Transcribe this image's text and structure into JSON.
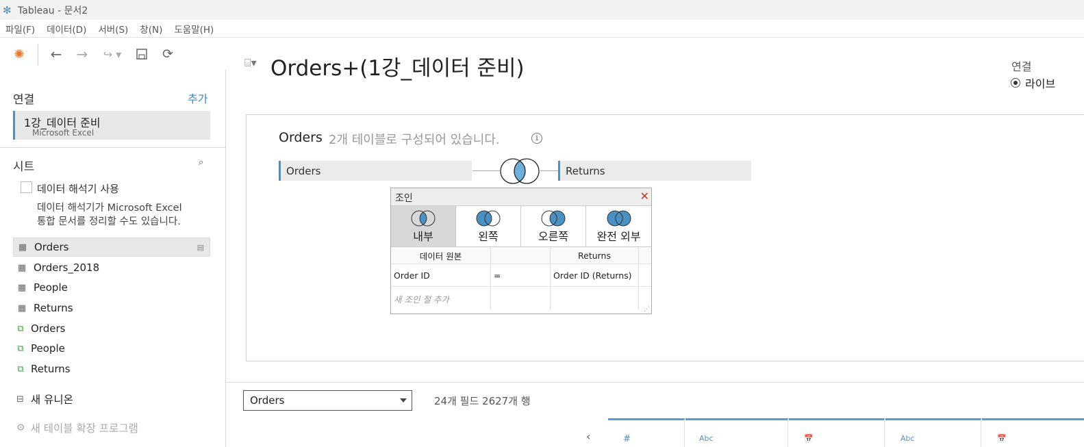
{
  "window": {
    "title": "Tableau - 문서2"
  },
  "menu": [
    "파일(F)",
    "데이터(D)",
    "서버(S)",
    "창(N)",
    "도움말(H)"
  ],
  "sidebar": {
    "connections_title": "연결",
    "add_label": "추가",
    "connection": {
      "name": "1강_데이터 준비",
      "type": "Microsoft Excel"
    },
    "sheets_title": "시트",
    "interpreter_label": "데이터 해석기 사용",
    "interpreter_hint_1": "데이터 해석기가 Microsoft Excel",
    "interpreter_hint_2": "통합 문서를 정리할 수도 있습니다.",
    "sheets": [
      {
        "label": "Orders",
        "kind": "table"
      },
      {
        "label": "Orders_2018",
        "kind": "table"
      },
      {
        "label": "People",
        "kind": "table"
      },
      {
        "label": "Returns",
        "kind": "table"
      },
      {
        "label": "Orders",
        "kind": "named-range"
      },
      {
        "label": "People",
        "kind": "named-range"
      },
      {
        "label": "Returns",
        "kind": "named-range"
      }
    ],
    "new_union": "새 유니온",
    "new_extension": "새 테이블 확장 프로그램"
  },
  "main": {
    "title": "Orders+(1강_데이터 준비)",
    "connection_label": "연결",
    "live_label": "라이브",
    "logical_table": "Orders",
    "logical_subtitle": "2개 테이블로 구성되어 있습니다.",
    "left_table": "Orders",
    "right_table": "Returns"
  },
  "join_dialog": {
    "title": "조인",
    "types": [
      "내부",
      "왼쪽",
      "오른쪽",
      "완전 외부"
    ],
    "active_type": "내부",
    "col_left_header": "데이터 원본",
    "col_right_header": "Returns",
    "clause": {
      "left": "Order ID",
      "op": "=",
      "right": "Order ID (Returns)"
    },
    "add_clause": "새 조인 절 추가"
  },
  "bottom": {
    "table_select": "Orders",
    "fields_info": "24개 필드 2627개 행",
    "column_types": [
      "#",
      "Abc",
      "📅",
      "Abc",
      "📅"
    ]
  },
  "colors": {
    "accent": "#4a90c2",
    "join_fill": "#4a90c2",
    "close": "#c0392b"
  }
}
